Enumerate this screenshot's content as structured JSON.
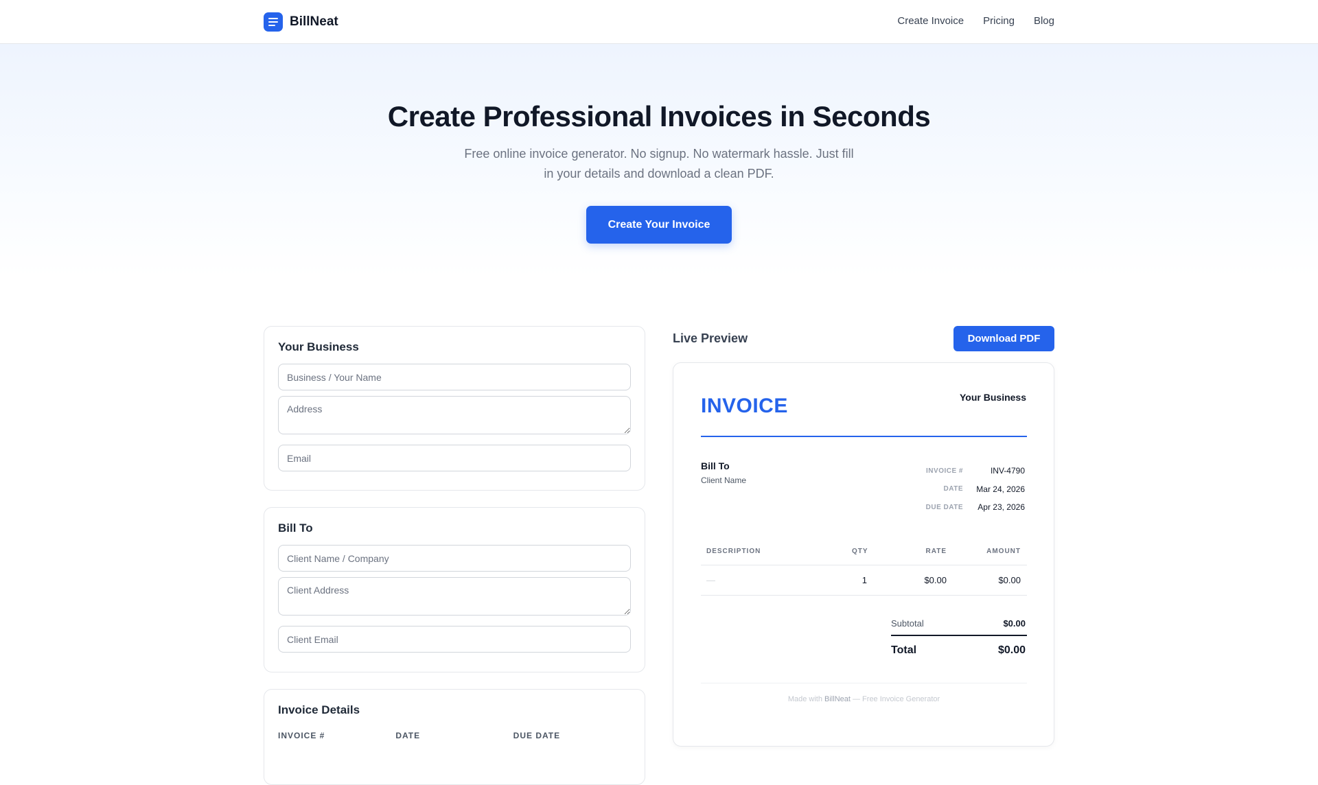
{
  "header": {
    "brand": "BillNeat",
    "nav": [
      "Create Invoice",
      "Pricing",
      "Blog"
    ]
  },
  "hero": {
    "title": "Create Professional Invoices in Seconds",
    "subtitle": "Free online invoice generator. No signup. No watermark hassle. Just fill in your details and download a clean PDF.",
    "cta": "Create Your Invoice"
  },
  "form": {
    "business": {
      "title": "Your Business",
      "name_placeholder": "Business / Your Name",
      "address_placeholder": "Address",
      "email_placeholder": "Email"
    },
    "bill_to": {
      "title": "Bill To",
      "name_placeholder": "Client Name / Company",
      "address_placeholder": "Client Address",
      "email_placeholder": "Client Email"
    },
    "details": {
      "title": "Invoice Details",
      "labels": [
        "INVOICE #",
        "DATE",
        "DUE DATE"
      ]
    }
  },
  "preview": {
    "title": "Live Preview",
    "download": "Download PDF",
    "invoice": {
      "heading": "INVOICE",
      "business": "Your Business",
      "bill_to_label": "Bill To",
      "client": "Client Name",
      "meta": [
        {
          "label": "INVOICE #",
          "value": "INV-4790"
        },
        {
          "label": "DATE",
          "value": "Mar 24, 2026"
        },
        {
          "label": "DUE DATE",
          "value": "Apr 23, 2026"
        }
      ],
      "columns": [
        "DESCRIPTION",
        "QTY",
        "RATE",
        "AMOUNT"
      ],
      "items": [
        {
          "description": "—",
          "qty": "1",
          "rate": "$0.00",
          "amount": "$0.00"
        }
      ],
      "subtotal_label": "Subtotal",
      "subtotal": "$0.00",
      "total_label": "Total",
      "total": "$0.00",
      "footer_prefix": "Made with",
      "footer_brand": "BillNeat",
      "footer_suffix": "— Free Invoice Generator"
    }
  },
  "colors": {
    "accent": "#2563eb",
    "text": "#111827",
    "muted": "#6b7280",
    "border": "#e5e7eb"
  }
}
